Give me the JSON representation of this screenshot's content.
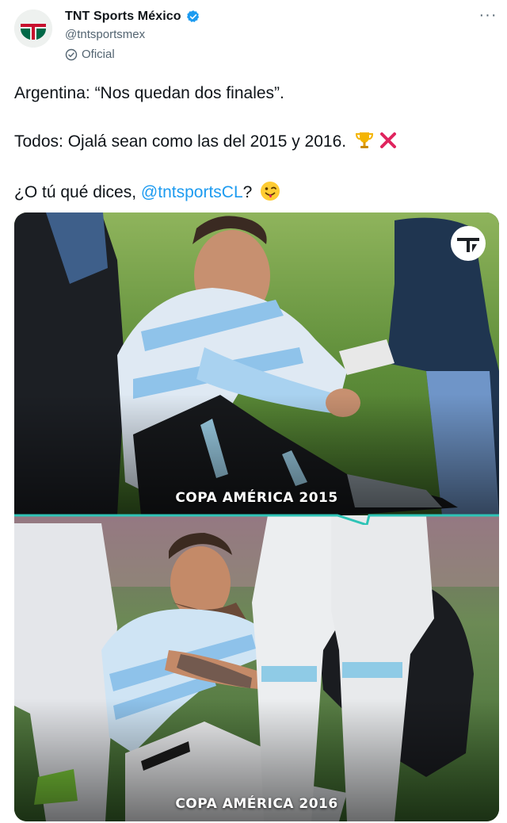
{
  "account": {
    "display_name": "TNT Sports México",
    "handle": "@tntsportsmex",
    "official_label": "Oficial"
  },
  "tweet": {
    "line1": "Argentina: “Nos quedan dos finales”.",
    "line2": "Todos: Ojalá sean como las del 2015 y 2016.",
    "line3_prefix": "¿O tú qué dices, ",
    "mention": "@tntsportsCL",
    "line3_suffix": "?"
  },
  "media": {
    "caption_top": "COPA AMÉRICA 2015",
    "caption_bottom": "COPA AMÉRICA 2016"
  },
  "icons": [
    "verified-badge-icon",
    "official-check-icon",
    "more-options-icon",
    "trophy-emoji-icon",
    "cross-mark-emoji-icon",
    "winking-tongue-emoji-icon",
    "tnt-logo-icon"
  ],
  "colors": {
    "link": "#1d9bf0",
    "verified": "#1d9bf0",
    "muted": "#536471",
    "accent_line": "#2ec4b6"
  }
}
